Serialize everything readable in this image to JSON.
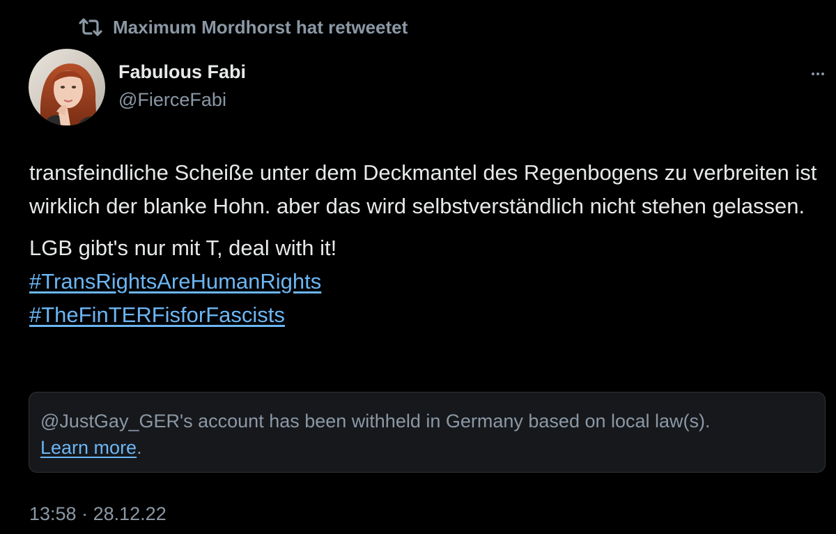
{
  "retweet": {
    "icon": "retweet-icon",
    "label": "Maximum Mordhorst hat retweetet"
  },
  "author": {
    "display_name": "Fabulous Fabi",
    "handle": "@FierceFabi",
    "avatar": "profile-photo"
  },
  "more_menu": {
    "icon": "more-horizontal-icon"
  },
  "tweet": {
    "paragraph1": "transfeindliche Scheiße unter dem Deckmantel des Regenbogens zu verbreiten ist wirklich der blanke Hohn. aber das wird selbstverständlich nicht stehen gelassen.",
    "line2": "LGB gibt's nur mit T, deal with it!",
    "hashtags": [
      "#TransRightsAreHumanRights",
      "#TheFinTERFisforFascists"
    ]
  },
  "notice": {
    "text": "@JustGay_GER's account has been withheld in Germany based on local law(s).",
    "link_label": "Learn more",
    "trailing": "."
  },
  "meta": {
    "time": "13:58",
    "separator": "·",
    "date": "28.12.22"
  },
  "colors": {
    "background": "#000000",
    "text_primary": "#e7e9ea",
    "text_secondary": "#8b98a5",
    "link": "#6cb6f4",
    "card_background": "#16181c",
    "card_border": "#2f3336"
  }
}
